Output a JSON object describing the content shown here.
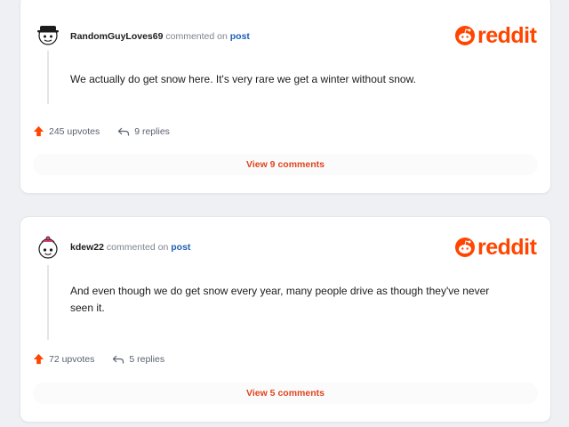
{
  "brand": {
    "logo_text": "reddit",
    "accent": "#ff4500"
  },
  "comments": [
    {
      "username": "RandomGuyLoves69",
      "action_text": "commented on",
      "post_link": "post",
      "body": "We actually do get snow here. It's very rare we get a winter without snow.",
      "upvotes": "245 upvotes",
      "replies": "9 replies",
      "view_comments": "View 9 comments",
      "avatar_icon": "snoo-avatar-hat-icon"
    },
    {
      "username": "kdew22",
      "action_text": "commented on",
      "post_link": "post",
      "body": "And even though we do get snow every year, many people drive as though they've never seen it.",
      "upvotes": "72 upvotes",
      "replies": "5 replies",
      "view_comments": "View 5 comments",
      "avatar_icon": "snoo-avatar-icon"
    }
  ],
  "icons": {
    "upvote": "upvote-arrow-icon",
    "reply": "reply-arrow-icon"
  },
  "colors": {
    "link": "#1f5fb8",
    "upvote": "#ff4500",
    "view_comments": "#e0451e"
  }
}
